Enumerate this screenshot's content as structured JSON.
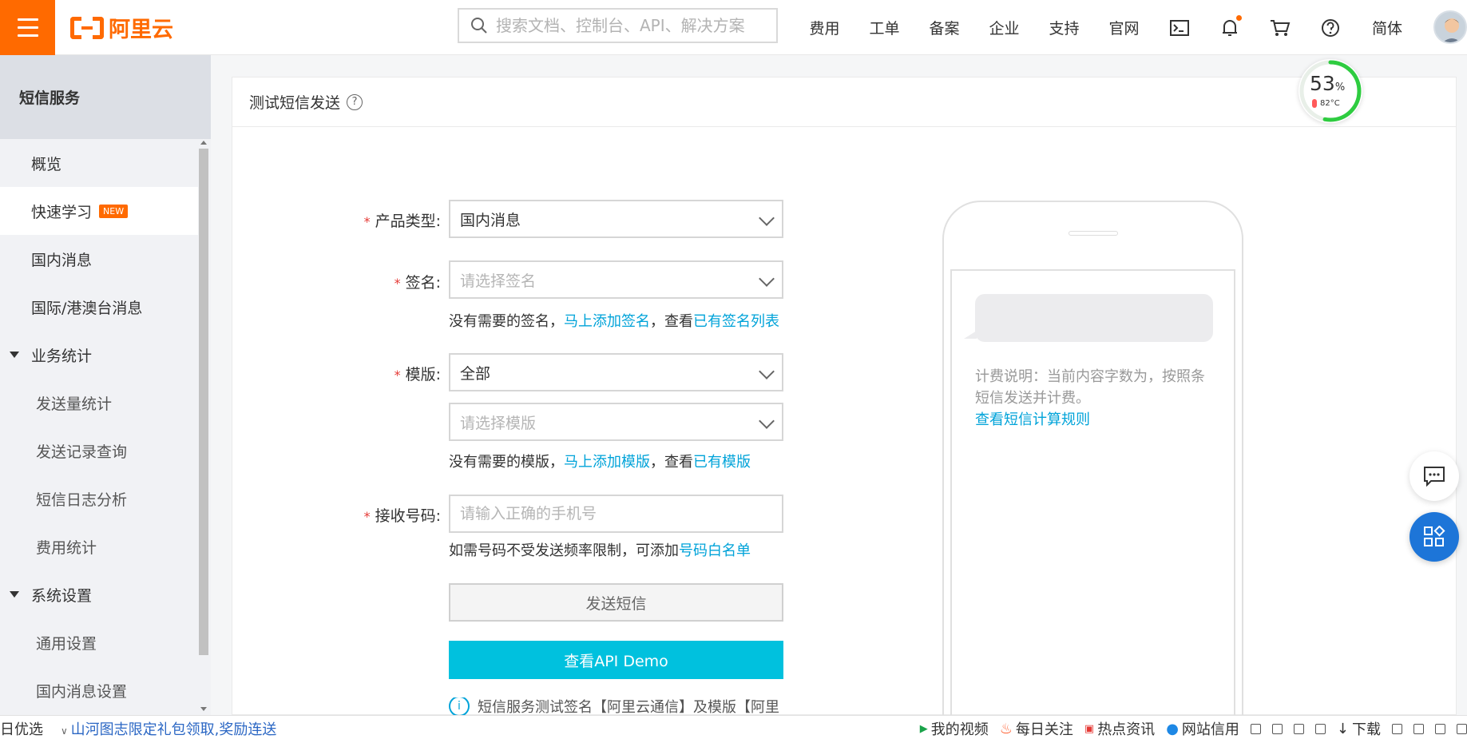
{
  "header": {
    "logo_text": "阿里云",
    "search_placeholder": "搜索文档、控制台、API、解决方案",
    "nav": [
      "费用",
      "工单",
      "备案",
      "企业",
      "支持",
      "官网"
    ],
    "lang": "简体"
  },
  "sidebar": {
    "title": "短信服务",
    "items": [
      {
        "label": "概览"
      },
      {
        "label": "快速学习",
        "badge": "NEW"
      },
      {
        "label": "国内消息"
      },
      {
        "label": "国际/港澳台消息"
      },
      {
        "label": "业务统计"
      },
      {
        "label": "发送量统计"
      },
      {
        "label": "发送记录查询"
      },
      {
        "label": "短信日志分析"
      },
      {
        "label": "费用统计"
      },
      {
        "label": "系统设置"
      },
      {
        "label": "通用设置"
      },
      {
        "label": "国内消息设置"
      }
    ]
  },
  "main": {
    "title": "测试短信发送",
    "help_symbol": "?",
    "required_mark": "*",
    "form": {
      "product_type_label": "产品类型:",
      "product_type_value": "国内消息",
      "sign_label": "签名:",
      "sign_placeholder": "请选择签名",
      "sign_hint_prefix": "没有需要的签名，",
      "sign_hint_link1": "马上添加签名",
      "sign_hint_mid": "，查看",
      "sign_hint_link2": "已有签名列表",
      "template_label": "模版:",
      "template_value": "全部",
      "template_placeholder": "请选择模版",
      "template_hint_prefix": "没有需要的模版，",
      "template_hint_link1": "马上添加模版",
      "template_hint_mid": "，查看",
      "template_hint_link2": "已有模版",
      "phone_label": "接收号码:",
      "phone_placeholder": "请输入正确的手机号",
      "phone_hint_prefix": "如需号码不受发送频率限制，可添加",
      "phone_hint_link": "号码白名单",
      "send_button": "发送短信",
      "demo_button": "查看API Demo",
      "info_symbol": "i",
      "notice": "短信服务测试签名【阿里云通信】及模版【阿里"
    },
    "phone_preview": {
      "billing_note": "计费说明：当前内容字数为，按照条短信发送并计费。",
      "rule_link": "查看短信计算规则"
    }
  },
  "gauge": {
    "percent": "53",
    "unit": "%",
    "temperature": "82°C",
    "percent_value": 53
  },
  "bottombar": {
    "left": "日优选",
    "promo": "山河图志限定礼包领取,奖励连送",
    "items": [
      "我的视频",
      "每日关注",
      "热点资讯",
      "网站信用",
      "下载"
    ]
  },
  "colors": {
    "brand": "#ff6a00",
    "link": "#00a3d9",
    "primary_button": "#00c1de",
    "gauge": "#2ecc40"
  }
}
